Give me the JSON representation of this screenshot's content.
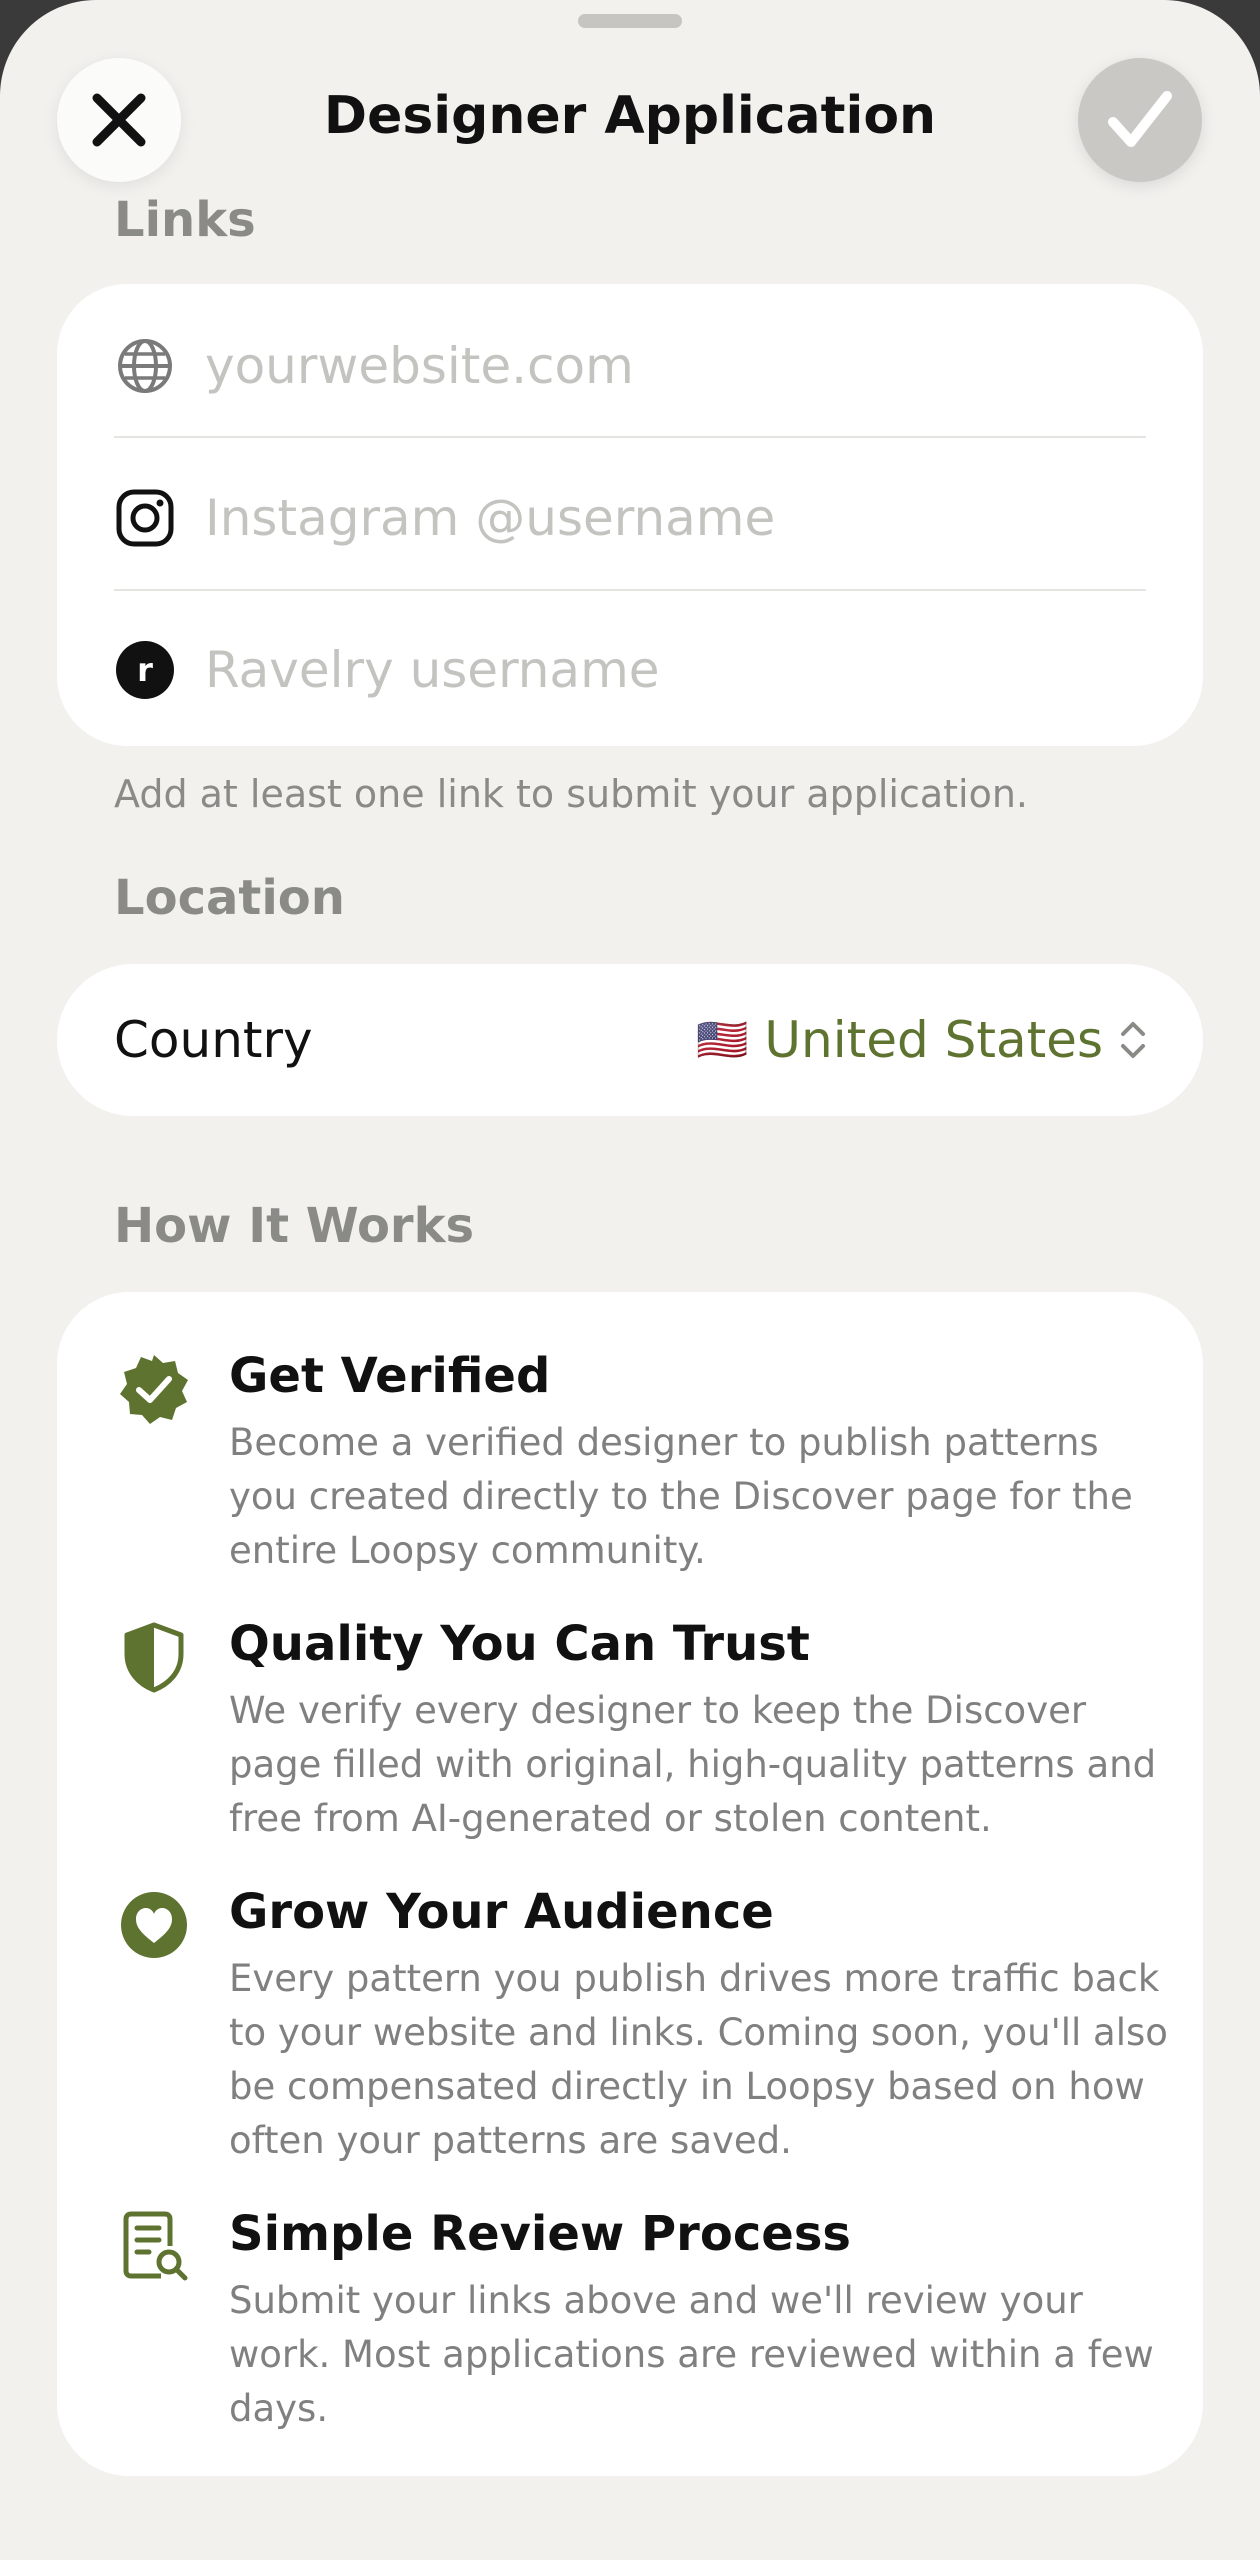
{
  "header": {
    "title": "Designer Application"
  },
  "links": {
    "section_title": "Links",
    "fields": [
      {
        "icon": "globe-icon",
        "placeholder": "yourwebsite.com"
      },
      {
        "icon": "instagram-icon",
        "placeholder": "Instagram @username"
      },
      {
        "icon": "ravelry-icon",
        "placeholder": "Ravelry username"
      }
    ],
    "note": "Add at least one link to submit your application."
  },
  "location": {
    "section_title": "Location",
    "country_label": "Country",
    "country_flag": "🇺🇸",
    "country_value": "United States"
  },
  "how_it_works": {
    "section_title": "How It Works",
    "items": [
      {
        "icon": "verified-badge-icon",
        "title": "Get Verified",
        "description": "Become a verified designer to publish patterns you created directly to the Discover page for the entire Loopsy community."
      },
      {
        "icon": "shield-icon",
        "title": "Quality You Can Trust",
        "description": "We verify every designer to keep the Discover page filled with original, high-quality patterns and free from AI-generated or stolen content."
      },
      {
        "icon": "heart-icon",
        "title": "Grow Your Audience",
        "description": "Every pattern you publish drives more traffic back to your website and links. Coming soon, you'll also be compensated directly in Loopsy based on how often your patterns are saved."
      },
      {
        "icon": "document-search-icon",
        "title": "Simple Review Process",
        "description": "Submit your links above and we'll review your work. Most applications are reviewed within a few days."
      }
    ]
  },
  "colors": {
    "accent": "#5f7330",
    "background": "#f2f1ee",
    "card": "#ffffff",
    "secondary_text": "#8a8a87"
  }
}
